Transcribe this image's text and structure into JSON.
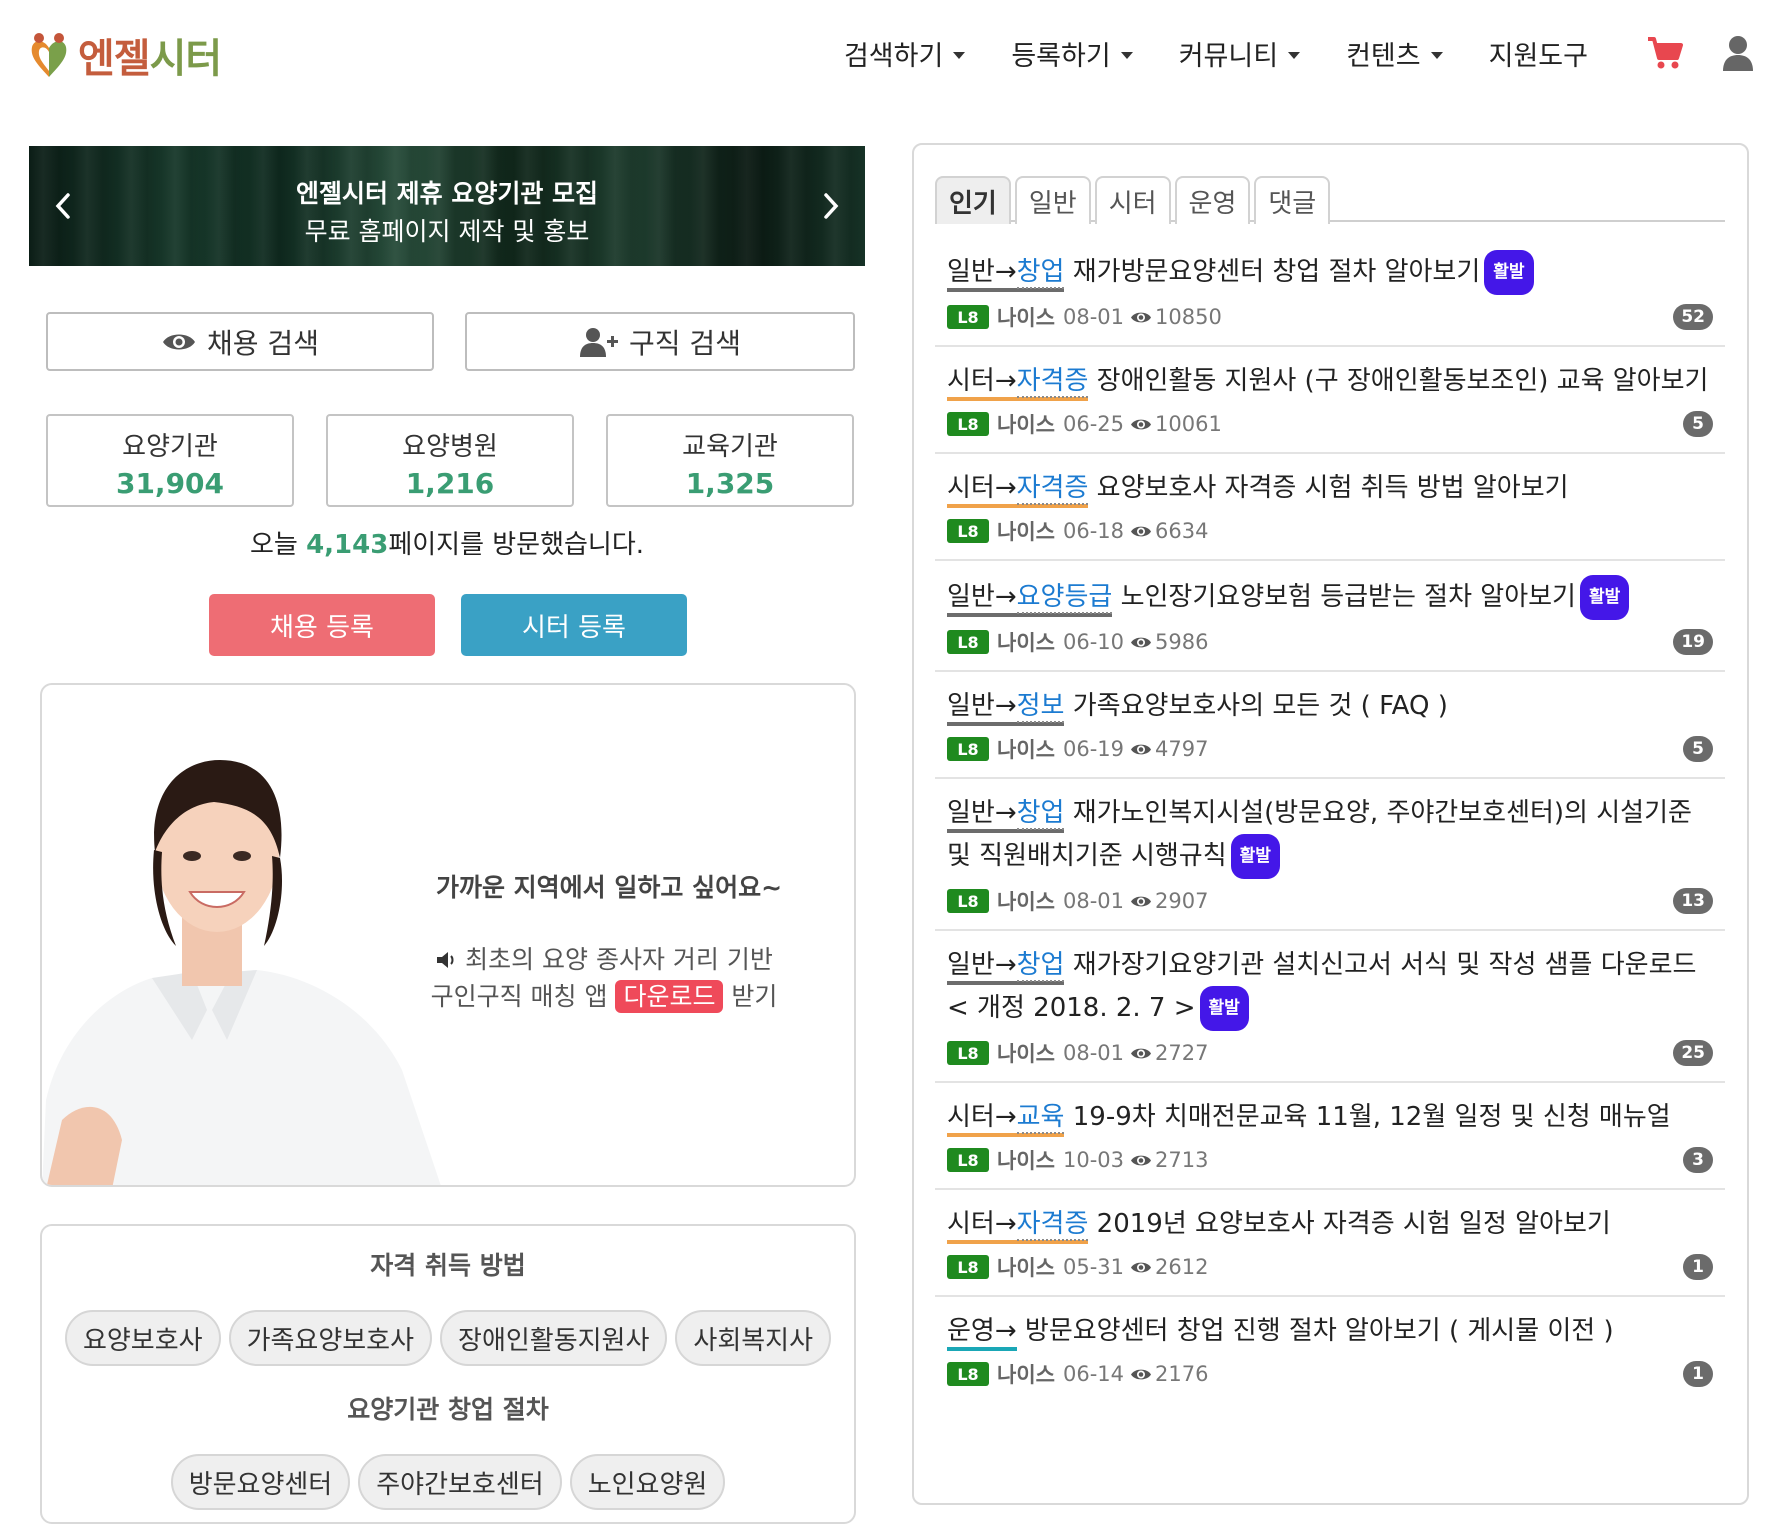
{
  "header": {
    "logo": {
      "part1": "엔젤",
      "part2": "시터"
    },
    "nav": [
      {
        "label": "검색하기",
        "dropdown": true
      },
      {
        "label": "등록하기",
        "dropdown": true
      },
      {
        "label": "커뮤니티",
        "dropdown": true
      },
      {
        "label": "컨텐츠",
        "dropdown": true
      },
      {
        "label": "지원도구",
        "dropdown": false
      }
    ],
    "icons": [
      "shopping-cart-icon",
      "user-icon"
    ],
    "cart_color": "#e8474f"
  },
  "banner": {
    "title": "엔젤시터 제휴 요양기관 모집",
    "subtitle": "무료 홈페이지 제작 및 홍보"
  },
  "search": {
    "job_search": "채용 검색",
    "seeker_search": "구직 검색"
  },
  "stats": [
    {
      "label": "요양기관",
      "value": "31,904"
    },
    {
      "label": "요양병원",
      "value": "1,216"
    },
    {
      "label": "교육기관",
      "value": "1,325"
    }
  ],
  "visits": {
    "prefix": "오늘 ",
    "count": "4,143",
    "suffix": "페이지를 방문했습니다."
  },
  "actions": {
    "job_register": "채용 등록",
    "sitter_register": "시터 등록",
    "job_register_color": "#ee6d74",
    "sitter_register_color": "#3aa1c5"
  },
  "promo": {
    "title": "가까운 지역에서 일하고 싶어요~",
    "line1": "최초의 요양 종사자 거리 기반",
    "line2_prefix": "구인구직 매칭 앱 ",
    "download": "다운로드",
    "line2_suffix": " 받기"
  },
  "licenses": {
    "title": "자격 취득 방법",
    "items": [
      "요양보호사",
      "가족요양보호사",
      "장애인활동지원사",
      "사회복지사"
    ]
  },
  "startup": {
    "title": "요양기관 창업 절차",
    "items": [
      "방문요양센터",
      "주야간보호센터",
      "노인요양원"
    ]
  },
  "board": {
    "tabs": [
      "인기",
      "일반",
      "시터",
      "운영",
      "댓글"
    ],
    "active_tab": 0,
    "posts": [
      {
        "cat": "일반",
        "sub": "창업",
        "title": "재가방문요양센터 창업 절차 알아보기",
        "hot": "활발",
        "level": "L8",
        "author": "나이스",
        "date": "08-01",
        "views": "10850",
        "comments": "52"
      },
      {
        "cat": "시터",
        "sub": "자격증",
        "title": "장애인활동 지원사 (구 장애인활동보조인) 교육 알아보기",
        "hot": "",
        "level": "L8",
        "author": "나이스",
        "date": "06-25",
        "views": "10061",
        "comments": "5"
      },
      {
        "cat": "시터",
        "sub": "자격증",
        "title": "요양보호사 자격증 시험 취득 방법 알아보기",
        "hot": "",
        "level": "L8",
        "author": "나이스",
        "date": "06-18",
        "views": "6634",
        "comments": ""
      },
      {
        "cat": "일반",
        "sub": "요양등급",
        "title": "노인장기요양보험 등급받는 절차 알아보기",
        "hot": "활발",
        "level": "L8",
        "author": "나이스",
        "date": "06-10",
        "views": "5986",
        "comments": "19"
      },
      {
        "cat": "일반",
        "sub": "정보",
        "title": "가족요양보호사의 모든 것 ( FAQ )",
        "hot": "",
        "level": "L8",
        "author": "나이스",
        "date": "06-19",
        "views": "4797",
        "comments": "5"
      },
      {
        "cat": "일반",
        "sub": "창업",
        "title": "재가노인복지시설(방문요양, 주야간보호센터)의 시설기준 및 직원배치기준 시행규칙",
        "hot": "활발",
        "level": "L8",
        "author": "나이스",
        "date": "08-01",
        "views": "2907",
        "comments": "13"
      },
      {
        "cat": "일반",
        "sub": "창업",
        "title": "재가장기요양기관 설치신고서 서식 및 작성 샘플 다운로드 < 개정 2018. 2. 7 >",
        "hot": "활발",
        "level": "L8",
        "author": "나이스",
        "date": "08-01",
        "views": "2727",
        "comments": "25"
      },
      {
        "cat": "시터",
        "sub": "교육",
        "title": "19-9차 치매전문교육 11월, 12월 일정 및 신청 매뉴얼",
        "hot": "",
        "level": "L8",
        "author": "나이스",
        "date": "10-03",
        "views": "2713",
        "comments": "3"
      },
      {
        "cat": "시터",
        "sub": "자격증",
        "title": "2019년 요양보호사 자격증 시험 일정 알아보기",
        "hot": "",
        "level": "L8",
        "author": "나이스",
        "date": "05-31",
        "views": "2612",
        "comments": "1"
      },
      {
        "cat": "운영",
        "sub": "",
        "title": "방문요양센터 창업 진행 절차 알아보기 ( 게시물 이전 )",
        "hot": "",
        "level": "L8",
        "author": "나이스",
        "date": "06-14",
        "views": "2176",
        "comments": "1"
      }
    ]
  }
}
